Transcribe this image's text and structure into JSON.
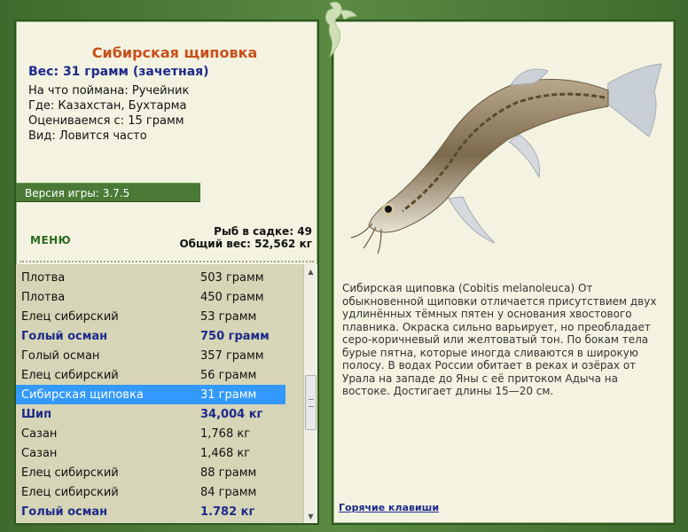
{
  "fish": {
    "title": "Сибирская щиповка",
    "weight": "Вес: 31 грамм (зачетная)",
    "caught_on": "На что поймана: Ручейник",
    "location": "Где: Казахстан, Бухтарма",
    "rated_from": "Оцениваемся с: 15 грамм",
    "view": "Вид: Ловится часто"
  },
  "version": "Версия игры: 3.7.5",
  "menu_label": "МЕНЮ",
  "stats": {
    "fish_in_keepnet": "Рыб в садке: 49",
    "total_weight": "Общий вес: 52,562 кг"
  },
  "catch_list": [
    {
      "name": "Плотва",
      "weight": "503 грамм",
      "bold": false,
      "selected": false
    },
    {
      "name": "Плотва",
      "weight": "450 грамм",
      "bold": false,
      "selected": false
    },
    {
      "name": "Елец сибирский",
      "weight": "53 грамм",
      "bold": false,
      "selected": false
    },
    {
      "name": "Голый осман",
      "weight": "750 грамм",
      "bold": true,
      "selected": false
    },
    {
      "name": "Голый осман",
      "weight": "357 грамм",
      "bold": false,
      "selected": false
    },
    {
      "name": "Елец сибирский",
      "weight": "56 грамм",
      "bold": false,
      "selected": false
    },
    {
      "name": "Сибирская щиповка",
      "weight": "31 грамм",
      "bold": false,
      "selected": true
    },
    {
      "name": "Шип",
      "weight": "34,004 кг",
      "bold": true,
      "selected": false
    },
    {
      "name": "Сазан",
      "weight": "1,768 кг",
      "bold": false,
      "selected": false
    },
    {
      "name": "Сазан",
      "weight": "1,468 кг",
      "bold": false,
      "selected": false
    },
    {
      "name": "Елец сибирский",
      "weight": "88 грамм",
      "bold": false,
      "selected": false
    },
    {
      "name": "Елец сибирский",
      "weight": "84 грамм",
      "bold": false,
      "selected": false
    },
    {
      "name": "Голый осман",
      "weight": "1.782 кг",
      "bold": true,
      "selected": false
    }
  ],
  "scrollbar": {
    "position": 0.55
  },
  "description": "Сибирская щиповка (Cobitis melanoleuca) От обыкновенной щиповки отличается присутствием двух удлинённых тёмных пятен у основания хвостового плавника. Окраска сильно варьирует, но преобладает серо-коричневый или желтоватый тон. По бокам тела бурые пятна, которые иногда сливаются в широкую полосу. В водах России обитает в реках и озёрах от Урала на западе до Яны с её притоком Адыча на востоке. Достигает длины 15—20 см.",
  "hotkeys_label": "Горячие клавиши",
  "colors": {
    "frame": "#4f7a3a",
    "panel": "#f4f3e2",
    "list_bg": "#d6d5b7",
    "title": "#c8501a",
    "bold_text": "#1d2a8a",
    "selection": "#3399ff"
  },
  "icons": {
    "decor": "lizard-ornament-icon",
    "scroll_up": "scroll-up-arrow-icon",
    "scroll_down": "scroll-down-arrow-icon"
  }
}
